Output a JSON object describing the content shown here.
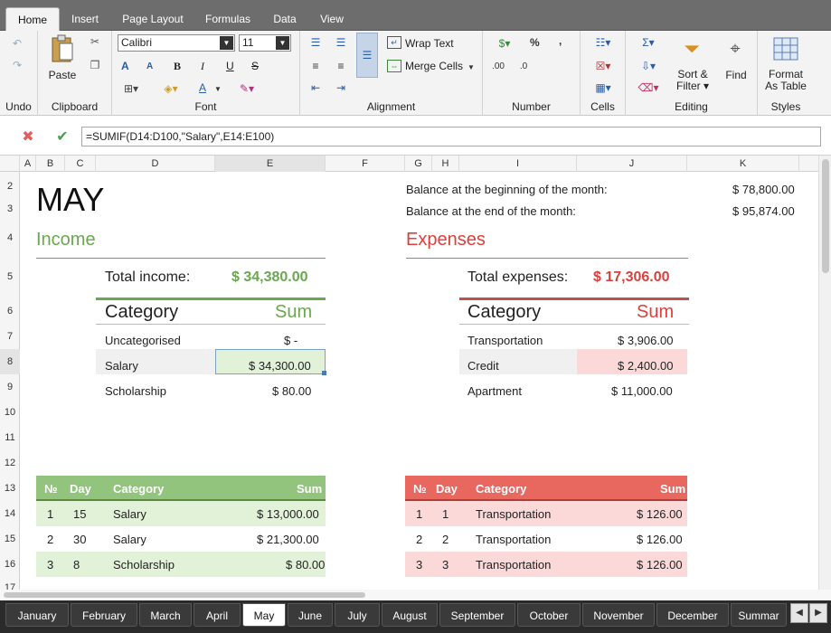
{
  "ribbon_tabs": [
    {
      "label": "Home"
    },
    {
      "label": "Insert"
    },
    {
      "label": "Page Layout"
    },
    {
      "label": "Formulas"
    },
    {
      "label": "Data"
    },
    {
      "label": "View"
    }
  ],
  "ribbon": {
    "groups": {
      "undo": "Undo",
      "clipboard": "Clipboard",
      "font": "Font",
      "alignment": "Alignment",
      "number": "Number",
      "cells": "Cells",
      "editing": "Editing",
      "styles": "Styles"
    },
    "paste": "Paste",
    "font_name": "Calibri",
    "font_size": "11",
    "bold": "B",
    "italic": "I",
    "underline": "U",
    "strike": "S",
    "grow": "A",
    "shrink": "A",
    "font_color": "A",
    "wrap_text": "Wrap Text",
    "merge_cells": "Merge Cells",
    "percent": "%",
    "comma": ",",
    "sort_filter_1": "Sort &",
    "sort_filter_2": "Filter",
    "find": "Find",
    "format_table_1": "Format",
    "format_table_2": "As Table"
  },
  "formula_bar": {
    "formula": "=SUMIF(D14:D100,\"Salary\",E14:E100)"
  },
  "columns": [
    "A",
    "B",
    "C",
    "D",
    "E",
    "F",
    "G",
    "H",
    "I",
    "J",
    "K"
  ],
  "rows": [
    "2",
    "3",
    "4",
    "5",
    "6",
    "7",
    "8",
    "9",
    "10",
    "11",
    "12",
    "13",
    "14",
    "15",
    "16",
    "17"
  ],
  "sheet": {
    "title": "MAY",
    "balance_begin_label": "Balance at the beginning of the month:",
    "balance_begin_value": "$ 78,800.00",
    "balance_end_label": "Balance at the end of the month:",
    "balance_end_value": "$ 95,874.00",
    "income": {
      "heading": "Income",
      "total_label": "Total income:",
      "total_value": "$ 34,380.00",
      "cat_header": "Category",
      "sum_header": "Sum",
      "rows": [
        {
          "category": "Uncategorised",
          "sum": "$ -"
        },
        {
          "category": "Salary",
          "sum": "$ 34,300.00"
        },
        {
          "category": "Scholarship",
          "sum": "$ 80.00"
        }
      ],
      "table_headers": [
        "№",
        "Day",
        "Category",
        "Sum"
      ],
      "table": [
        {
          "no": "1",
          "day": "15",
          "category": "Salary",
          "sum": "$ 13,000.00"
        },
        {
          "no": "2",
          "day": "30",
          "category": "Salary",
          "sum": "$ 21,300.00"
        },
        {
          "no": "3",
          "day": "8",
          "category": "Scholarship",
          "sum": "$ 80.00"
        }
      ]
    },
    "expenses": {
      "heading": "Expenses",
      "total_label": "Total expenses:",
      "total_value": "$ 17,306.00",
      "cat_header": "Category",
      "sum_header": "Sum",
      "rows": [
        {
          "category": "Transportation",
          "sum": "$ 3,906.00"
        },
        {
          "category": "Credit",
          "sum": "$ 2,400.00"
        },
        {
          "category": "Apartment",
          "sum": "$ 11,000.00"
        }
      ],
      "table_headers": [
        "№",
        "Day",
        "Category",
        "Sum"
      ],
      "table": [
        {
          "no": "1",
          "day": "1",
          "category": "Transportation",
          "sum": "$ 126.00"
        },
        {
          "no": "2",
          "day": "2",
          "category": "Transportation",
          "sum": "$ 126.00"
        },
        {
          "no": "3",
          "day": "3",
          "category": "Transportation",
          "sum": "$ 126.00"
        }
      ]
    }
  },
  "sheet_tabs": [
    "January",
    "February",
    "March",
    "April",
    "May",
    "June",
    "July",
    "August",
    "September",
    "October",
    "November",
    "December",
    "Summar"
  ],
  "colors": {
    "income": "#6aa84f",
    "expense": "#d9413b",
    "income_fill": "#e2f2d9",
    "expense_fill": "#fbd9d9"
  }
}
